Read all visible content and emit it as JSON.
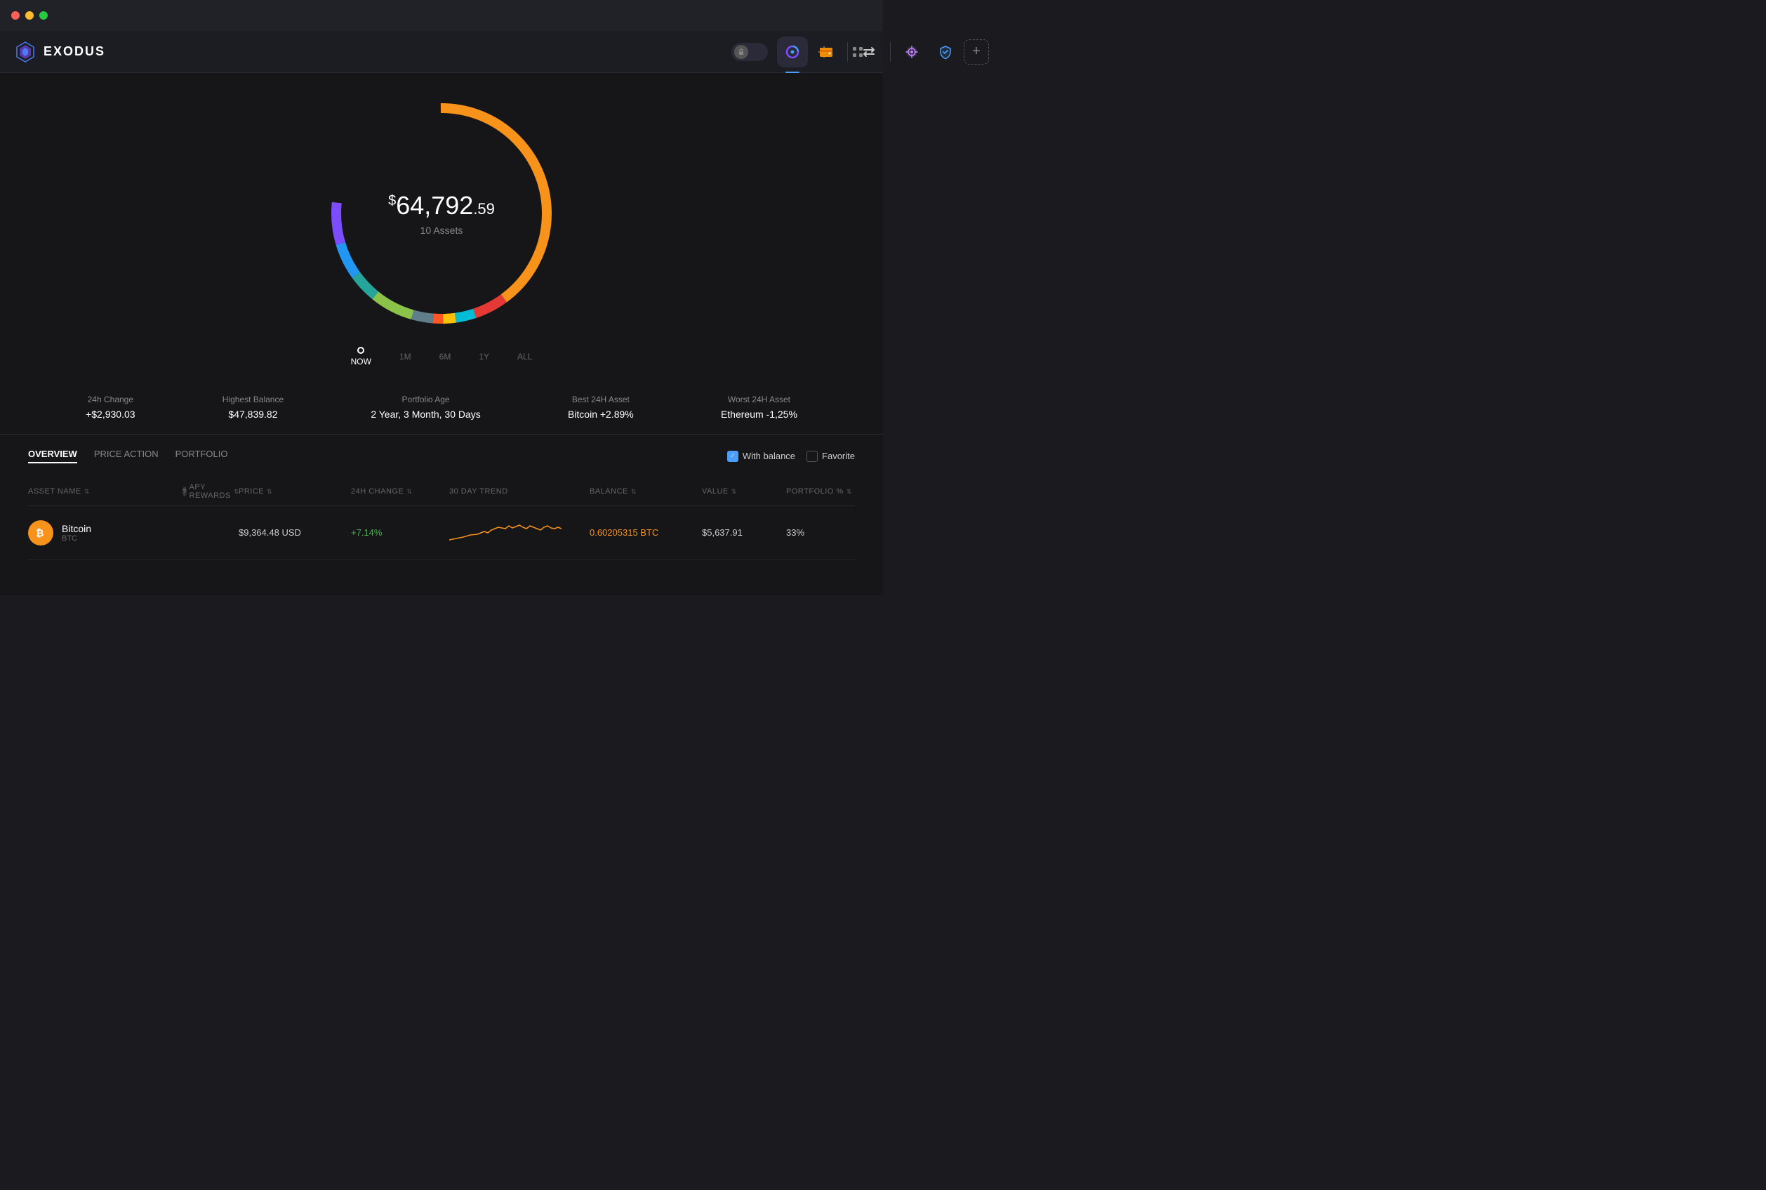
{
  "app": {
    "title": "EXODUS",
    "window_controls": [
      "close",
      "minimize",
      "maximize"
    ]
  },
  "nav": {
    "tabs": [
      {
        "id": "portfolio",
        "label": "Portfolio",
        "active": true
      },
      {
        "id": "wallet",
        "label": "Wallet",
        "active": false
      },
      {
        "id": "exchange",
        "label": "Exchange",
        "active": false
      },
      {
        "id": "apps",
        "label": "Apps",
        "active": false
      },
      {
        "id": "passkey",
        "label": "Passkey",
        "active": false
      }
    ],
    "add_label": "+",
    "right_icons": [
      "lock",
      "history",
      "settings",
      "grid"
    ]
  },
  "chart": {
    "amount_prefix": "$",
    "amount_main": "64,792",
    "amount_cents": ".59",
    "subtitle": "10 Assets"
  },
  "time_options": [
    {
      "label": "NOW",
      "active": true,
      "has_dot": true
    },
    {
      "label": "1M",
      "active": false
    },
    {
      "label": "6M",
      "active": false
    },
    {
      "label": "1Y",
      "active": false
    },
    {
      "label": "ALL",
      "active": false
    }
  ],
  "stats": [
    {
      "label": "24h Change",
      "value": "+$2,930.03"
    },
    {
      "label": "Highest Balance",
      "value": "$47,839.82"
    },
    {
      "label": "Portfolio Age",
      "value": "2 Year, 3 Month, 30 Days"
    },
    {
      "label": "Best 24H Asset",
      "value": "Bitcoin +2.89%"
    },
    {
      "label": "Worst 24H Asset",
      "value": "Ethereum -1,25%"
    }
  ],
  "table": {
    "tabs": [
      {
        "label": "OVERVIEW",
        "active": true
      },
      {
        "label": "PRICE ACTION",
        "active": false
      },
      {
        "label": "PORTFOLIO",
        "active": false
      }
    ],
    "filters": [
      {
        "label": "With balance",
        "checked": true
      },
      {
        "label": "Favorite",
        "checked": false
      }
    ],
    "columns": [
      {
        "label": "ASSET NAME",
        "sortable": true
      },
      {
        "label": "APY REWARDS",
        "sortable": true,
        "help": true
      },
      {
        "label": "PRICE",
        "sortable": true
      },
      {
        "label": "24H CHANGE",
        "sortable": true
      },
      {
        "label": "30 DAY TREND",
        "sortable": false
      },
      {
        "label": "BALANCE",
        "sortable": true
      },
      {
        "label": "VALUE",
        "sortable": true
      },
      {
        "label": "PORTFOLIO %",
        "sortable": true
      }
    ],
    "rows": [
      {
        "name": "Bitcoin",
        "ticker": "BTC",
        "icon_color": "#f7931a",
        "icon_text": "₿",
        "icon_bg": "#f7931a",
        "apy": "",
        "price": "$9,364.48 USD",
        "change": "+7.14%",
        "change_positive": true,
        "balance": "0.60205315 BTC",
        "balance_color": "#f7931a",
        "value": "$5,637.91",
        "portfolio": "33%"
      }
    ]
  }
}
